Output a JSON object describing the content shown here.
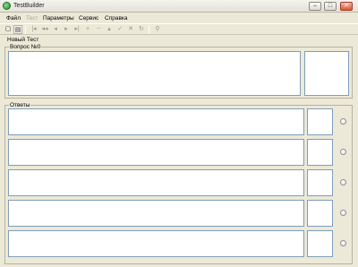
{
  "window": {
    "title": "TestBuilder",
    "minimize_glyph": "–",
    "maximize_glyph": "□",
    "close_glyph": "✕"
  },
  "menu": [
    {
      "label": "Файл",
      "enabled": true
    },
    {
      "label": "Тест",
      "enabled": false
    },
    {
      "label": "Параметры",
      "enabled": true
    },
    {
      "label": "Сервис",
      "enabled": true
    },
    {
      "label": "Справка",
      "enabled": true
    }
  ],
  "toolbar": [
    {
      "icon": "new-file-icon",
      "glyph": "▢",
      "enabled": true
    },
    {
      "icon": "open-folder-icon",
      "glyph": "▤",
      "enabled": true
    },
    {
      "icon": "first-record-icon",
      "glyph": "|◂",
      "enabled": false
    },
    {
      "icon": "prev-page-icon",
      "glyph": "◂◂",
      "enabled": false
    },
    {
      "icon": "prev-record-icon",
      "glyph": "◂",
      "enabled": false
    },
    {
      "icon": "next-record-icon",
      "glyph": "▸",
      "enabled": false
    },
    {
      "icon": "last-record-icon",
      "glyph": "▸|",
      "enabled": false
    },
    {
      "icon": "add-record-icon",
      "glyph": "+",
      "enabled": false
    },
    {
      "icon": "delete-record-icon",
      "glyph": "−",
      "enabled": false
    },
    {
      "icon": "edit-record-icon",
      "glyph": "▴",
      "enabled": false
    },
    {
      "icon": "post-record-icon",
      "glyph": "✓",
      "enabled": false
    },
    {
      "icon": "cancel-record-icon",
      "glyph": "✕",
      "enabled": false
    },
    {
      "icon": "refresh-icon",
      "glyph": "↻",
      "enabled": false
    },
    {
      "icon": "extra-tool-icon",
      "glyph": "⚲",
      "enabled": false
    }
  ],
  "test_name_label": "Новый Тест",
  "question_group": {
    "title": "Вопрос №0"
  },
  "answers_group": {
    "title": "Ответы"
  },
  "answers": [
    {
      "text": "",
      "score": "",
      "selected": false
    },
    {
      "text": "",
      "score": "",
      "selected": false
    },
    {
      "text": "",
      "score": "",
      "selected": false
    },
    {
      "text": "",
      "score": "",
      "selected": false
    },
    {
      "text": "",
      "score": "",
      "selected": false
    }
  ]
}
